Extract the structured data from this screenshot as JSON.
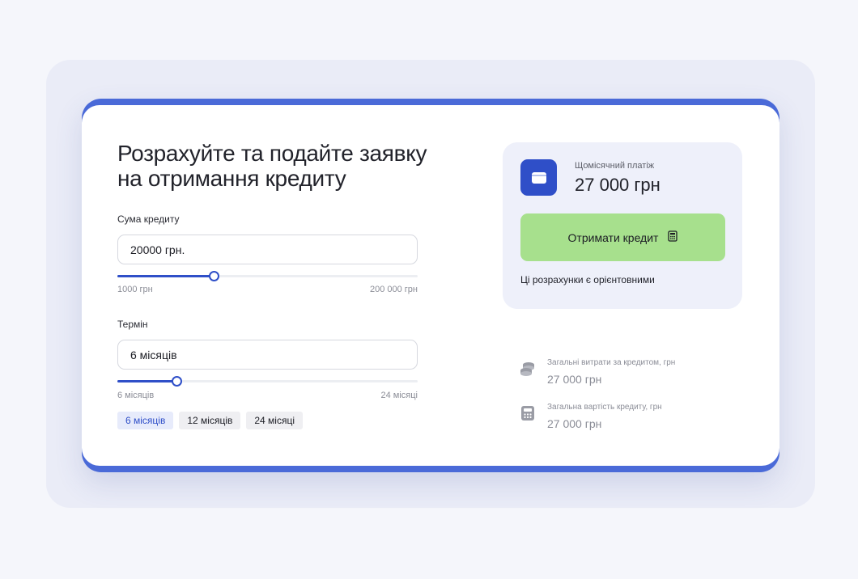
{
  "form": {
    "title_line1": "Розрахуйте та подайте заявку",
    "title_line2": "на отримання кредиту",
    "amount": {
      "label": "Сума кредиту",
      "value": "20000 грн.",
      "min_label": "1000 грн",
      "max_label": "200 000 грн",
      "min": 1000,
      "max": 200000,
      "current": 20000
    },
    "term": {
      "label": "Термін",
      "value": "6 місяців",
      "min_label": "6 місяців",
      "max_label": "24 місяці",
      "min": 0,
      "max": 24,
      "current": 6
    },
    "chips": [
      {
        "label": "6 місяців",
        "active": true
      },
      {
        "label": "12 місяців",
        "active": false
      },
      {
        "label": "24 місяці",
        "active": false
      }
    ]
  },
  "summary": {
    "monthly_label": "Щомісячний платіж",
    "monthly_value": "27 000 грн",
    "cta_label": "Отримати кредит",
    "note": "Ці розрахунки є орієнтовними",
    "stats": [
      {
        "label": "Загальні витрати за кредитом, грн",
        "value": "27 000 грн",
        "icon": "coins-stack-icon"
      },
      {
        "label": "Загальна вартість кредиту, грн",
        "value": "27 000 грн",
        "icon": "calculator-icon"
      }
    ]
  },
  "colors": {
    "accent": "#2f4fc8",
    "cta": "#a7e08d",
    "panel": "#eef0fa"
  }
}
